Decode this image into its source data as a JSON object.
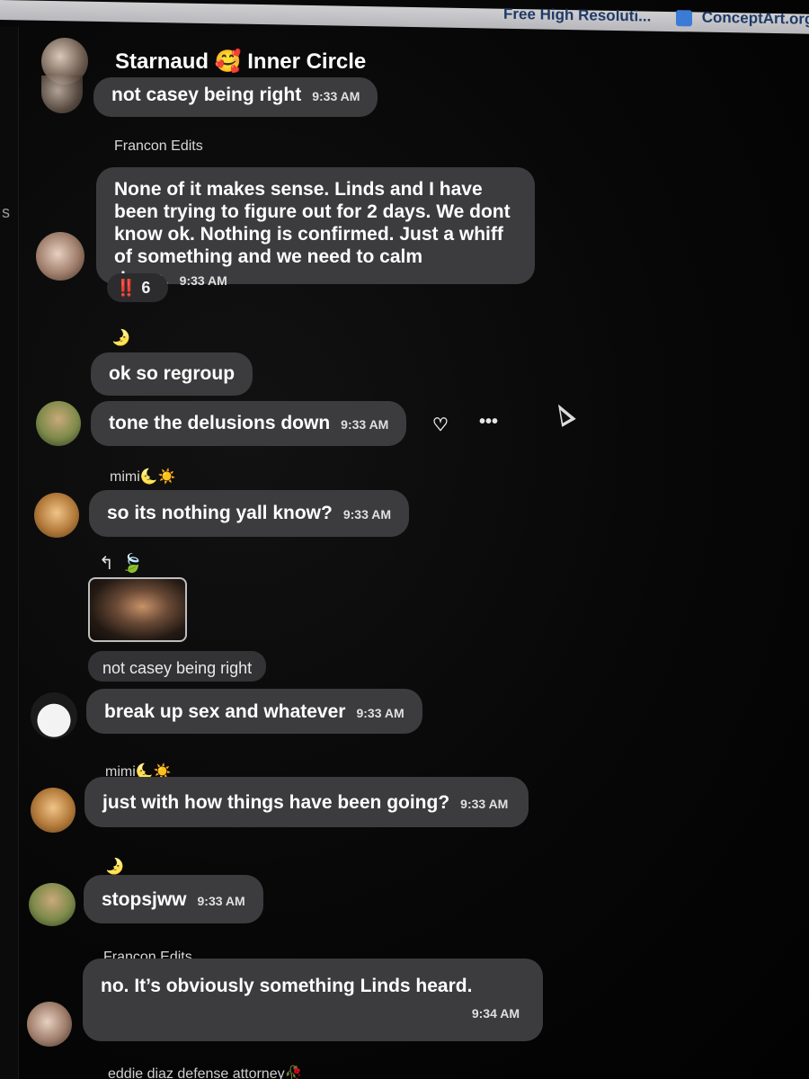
{
  "browser": {
    "bookmarks": [
      {
        "label": "Free High Resoluti..."
      },
      {
        "label": "ConceptArt.org"
      }
    ]
  },
  "sidebar_edge": {
    "letter": "s"
  },
  "chat": {
    "title": "Starnaud 🥰 Inner Circle",
    "messages": [
      {
        "text": "not casey being right",
        "time": "9:33 AM"
      },
      {
        "sender": "Francon Edits",
        "text": "None of it makes sense. Linds and I have been trying to figure out for 2 days. We dont know ok. Nothing is confirmed. Just a whiff of something and we need to calm down.",
        "time": "9:33 AM",
        "reaction": {
          "emoji": "‼️",
          "count": "6"
        }
      },
      {
        "sender_icon": "🌛",
        "text": "ok so regroup"
      },
      {
        "text": "tone the delusions down",
        "time": "9:33 AM"
      },
      {
        "sender": "mimi🌜☀️",
        "text": "so its nothing yall know?",
        "time": "9:33 AM"
      },
      {
        "reply_arrow": "↰",
        "reply_leaf": "🍃",
        "quoted": "not casey being right",
        "text": "break up sex and whatever",
        "time": "9:33 AM"
      },
      {
        "sender": "mimi🌜☀️",
        "text": "just with how things have been going?",
        "time": "9:33 AM"
      },
      {
        "sender_icon": "🌛",
        "text": "stopsjww",
        "time": "9:33 AM"
      },
      {
        "sender": "Francon Edits",
        "text": "no. It’s obviously something Linds heard.",
        "time": "9:34 AM"
      }
    ],
    "next_sender": "eddie diaz defense attorney🥀"
  },
  "hover_actions": {
    "react_icon": "heart-plus-icon",
    "more_icon": "more-icon"
  }
}
